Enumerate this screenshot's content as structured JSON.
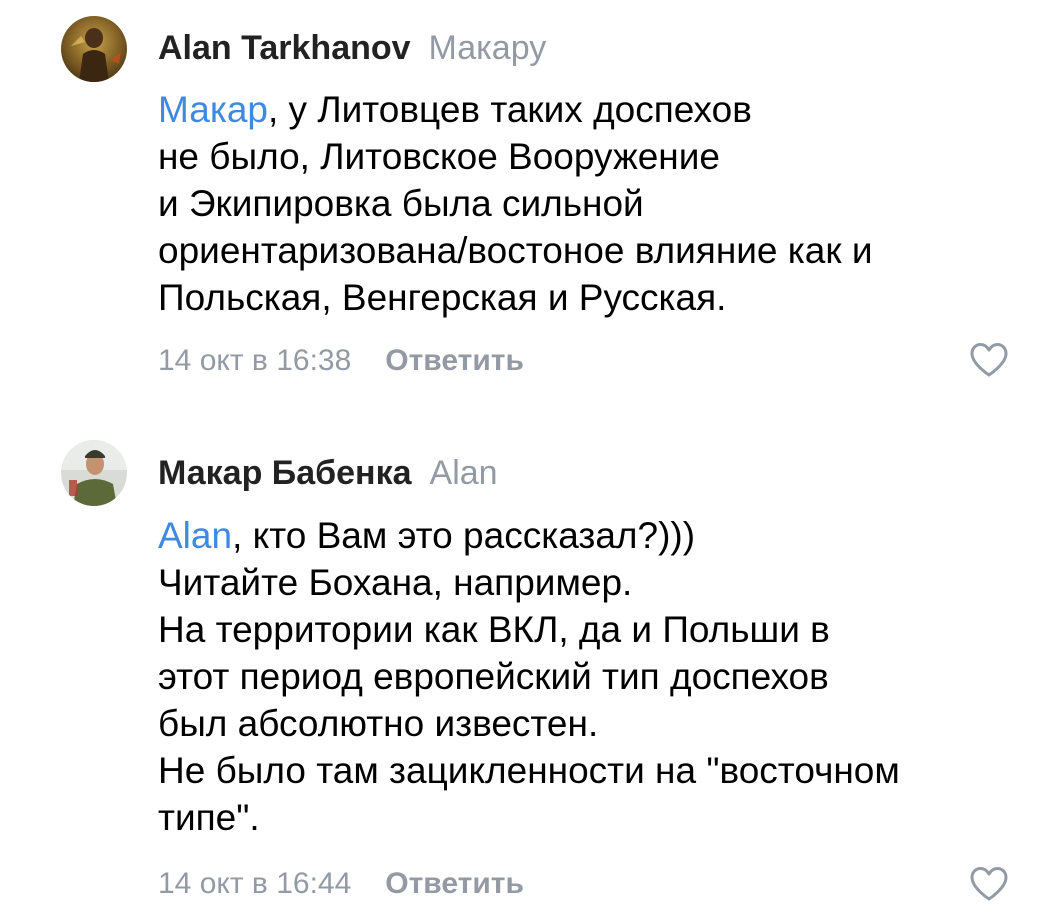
{
  "comments": [
    {
      "author": "Alan Tarkhanov",
      "reply_to": "Макару",
      "mention": "Макар",
      "lines": [
        ", у Литовцев таких доспехов",
        "не было, Литовское Вооружение",
        "и Экипировка была сильной",
        "ориентаризована/востоное влияние как и",
        "Польская, Венгерская и Русская."
      ],
      "timestamp": "14 окт в 16:38",
      "reply_label": "Ответить",
      "avatar_icon": "avatar-photo-warrior",
      "like_icon": "heart-outline-icon"
    },
    {
      "author": "Макар Бабенка",
      "reply_to": "Alan",
      "mention": "Alan",
      "lines": [
        ", кто Вам это рассказал?)))",
        "Читайте Бохана, например.",
        "На территории как ВКЛ, да и Польши в",
        "этот период европейский тип доспехов",
        "был абсолютно известен.",
        "Не было там зацикленности на \"восточном",
        "типе\"."
      ],
      "timestamp": "14 окт в 16:44",
      "reply_label": "Ответить",
      "avatar_icon": "avatar-photo-soldier",
      "like_icon": "heart-outline-icon"
    }
  ],
  "colors": {
    "mention": "#3f8ae0",
    "secondary": "#939aa3",
    "author": "#222222"
  }
}
